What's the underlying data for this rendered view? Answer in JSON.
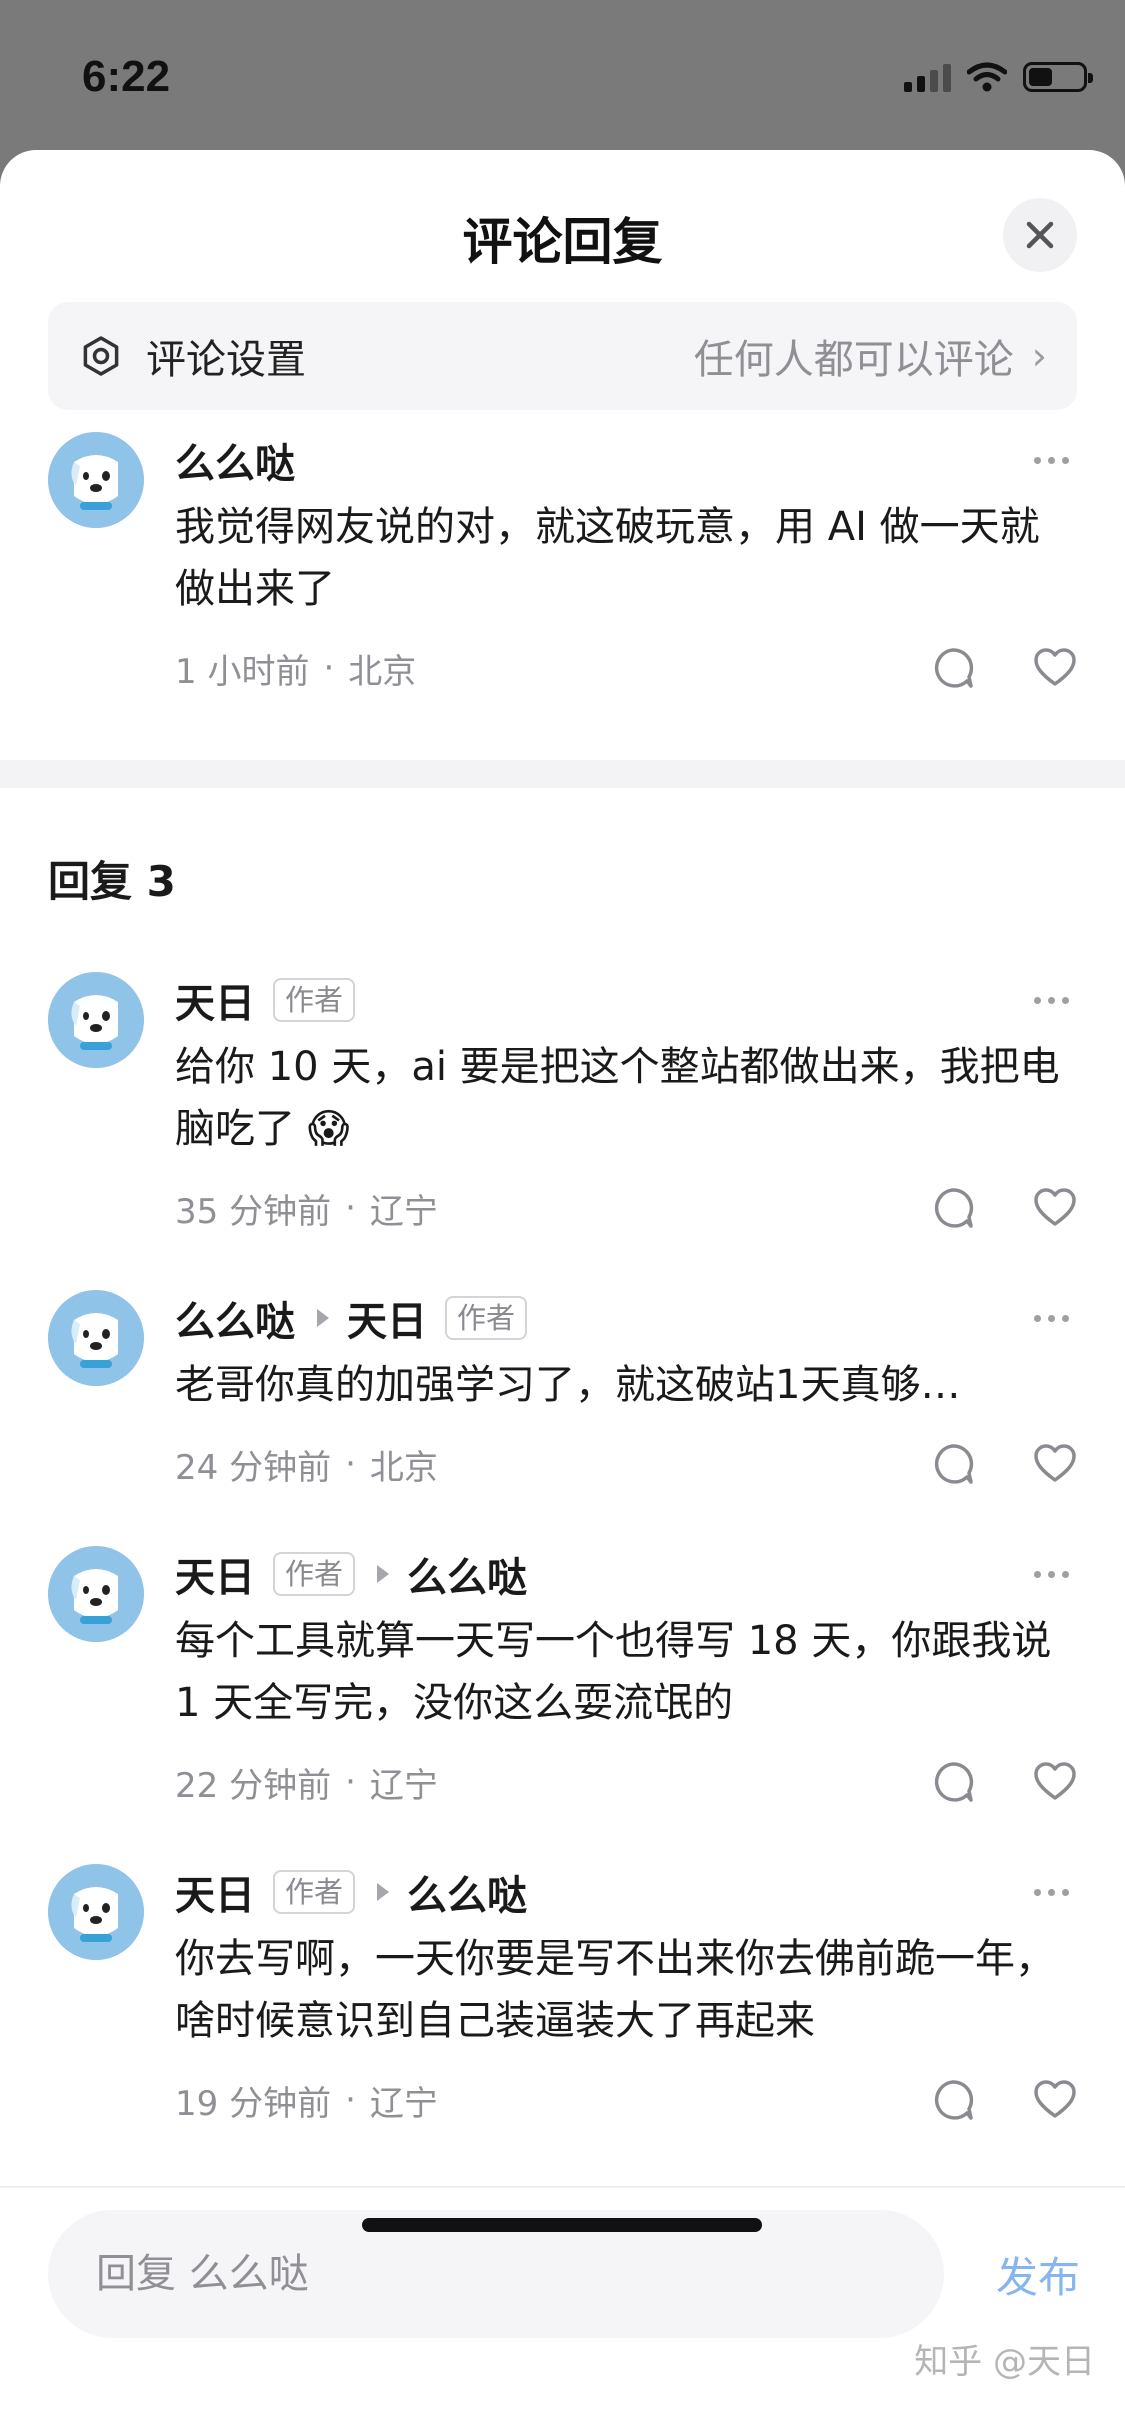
{
  "status_bar": {
    "time": "6:22",
    "battery_level": 0.45
  },
  "header": {
    "title": "评论回复",
    "close_icon": "close-icon"
  },
  "settings": {
    "label": "评论设置",
    "value": "任何人都可以评论",
    "chevron": "›",
    "icon": "gear-icon"
  },
  "main_comment": {
    "name": "么么哒",
    "text": "我觉得网友说的对，就这破玩意，用 AI 做一天就做出来了",
    "time": "1 小时前",
    "location": "北京"
  },
  "replies_header": "回复 3",
  "replies": [
    {
      "name": "天日",
      "badge": "作者",
      "reply_to": "",
      "reply_to_badge": "",
      "text": "给你 10 天，ai 要是把这个整站都做出来，我把电脑吃了 😱",
      "time": "35 分钟前",
      "location": "辽宁"
    },
    {
      "name": "么么哒",
      "badge": "",
      "reply_to": "天日",
      "reply_to_badge": "作者",
      "text": "老哥你真的加强学习了，就这破站1天真够…",
      "time": "24 分钟前",
      "location": "北京"
    },
    {
      "name": "天日",
      "badge": "作者",
      "reply_to": "么么哒",
      "reply_to_badge": "",
      "text": "每个工具就算一天写一个也得写 18 天，你跟我说 1 天全写完，没你这么耍流氓的",
      "time": "22 分钟前",
      "location": "辽宁"
    },
    {
      "name": "天日",
      "badge": "作者",
      "reply_to": "么么哒",
      "reply_to_badge": "",
      "text": "你去写啊，一天你要是写不出来你去佛前跪一年，啥时候意识到自己装逼装大了再起来",
      "time": "19 分钟前",
      "location": "辽宁"
    }
  ],
  "separator": "·",
  "composer": {
    "placeholder": "回复 么么哒",
    "publish_label": "发布"
  },
  "watermark": "知乎 @天日",
  "colors": {
    "accent": "#86b5ef",
    "muted": "#8f8f95",
    "sheet_bg": "#ffffff",
    "backdrop": "#7a7a7a"
  }
}
